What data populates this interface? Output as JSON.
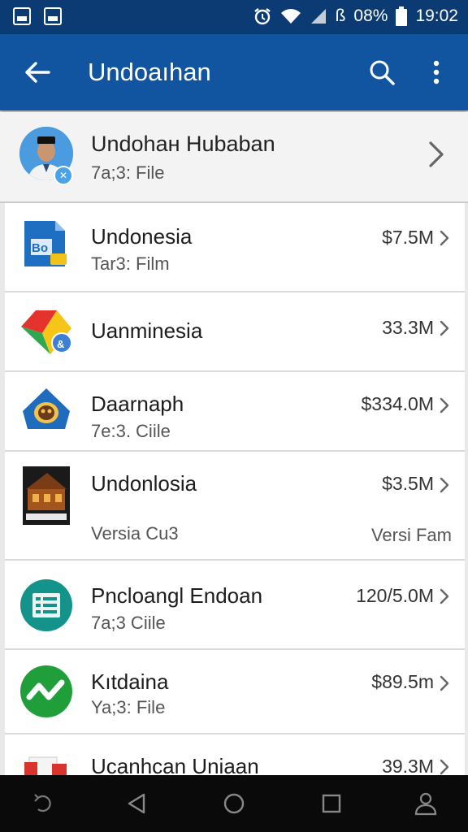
{
  "status_bar": {
    "battery_text": "08%",
    "time": "19:02",
    "left_icons": [
      "gallery-icon",
      "notification-icon"
    ],
    "right_icons": [
      "alarm-icon",
      "wifi-icon",
      "signal-icon",
      "battery-icon"
    ],
    "battery_prefix": "ß"
  },
  "app_bar": {
    "title": "Undoaıhan",
    "icons": [
      "back-arrow-icon",
      "search-icon",
      "more-vert-icon"
    ]
  },
  "header_item": {
    "title": "Undohaн Ηubaban",
    "subtitle": "7a;3: File"
  },
  "items": [
    {
      "name": "Undonesia",
      "subtitle": "Tar3: Film",
      "size": "$7.5M",
      "extra": ""
    },
    {
      "name": "Uanminesia",
      "subtitle": "",
      "size": "33.3M",
      "extra": ""
    },
    {
      "name": "Daarnaph",
      "subtitle": "7e:3. Ciile",
      "size": "$334.0M",
      "extra": ""
    },
    {
      "name": "Undonlosia",
      "subtitle": "Versia Cu3",
      "size": "$3.5M",
      "extra": "Versi Fam"
    },
    {
      "name": "Pncloangl Endoan",
      "subtitle": "7a;3 Ciile",
      "size": "120/5.0M",
      "extra": ""
    },
    {
      "name": "Kıtdaina",
      "subtitle": "Ya;3: File",
      "size": "$89.5m",
      "extra": ""
    },
    {
      "name": "Ucanhcan Uniaan",
      "subtitle": "",
      "size": "39.3M",
      "extra": ""
    }
  ],
  "nav_bar": {
    "icons": [
      "recent-back-icon",
      "back-triangle-icon",
      "home-circle-icon",
      "overview-square-icon",
      "person-icon"
    ]
  },
  "colors": {
    "status_bar": "#0b3b72",
    "app_bar": "#1155a0",
    "nav_bar": "#0a0a0a"
  }
}
